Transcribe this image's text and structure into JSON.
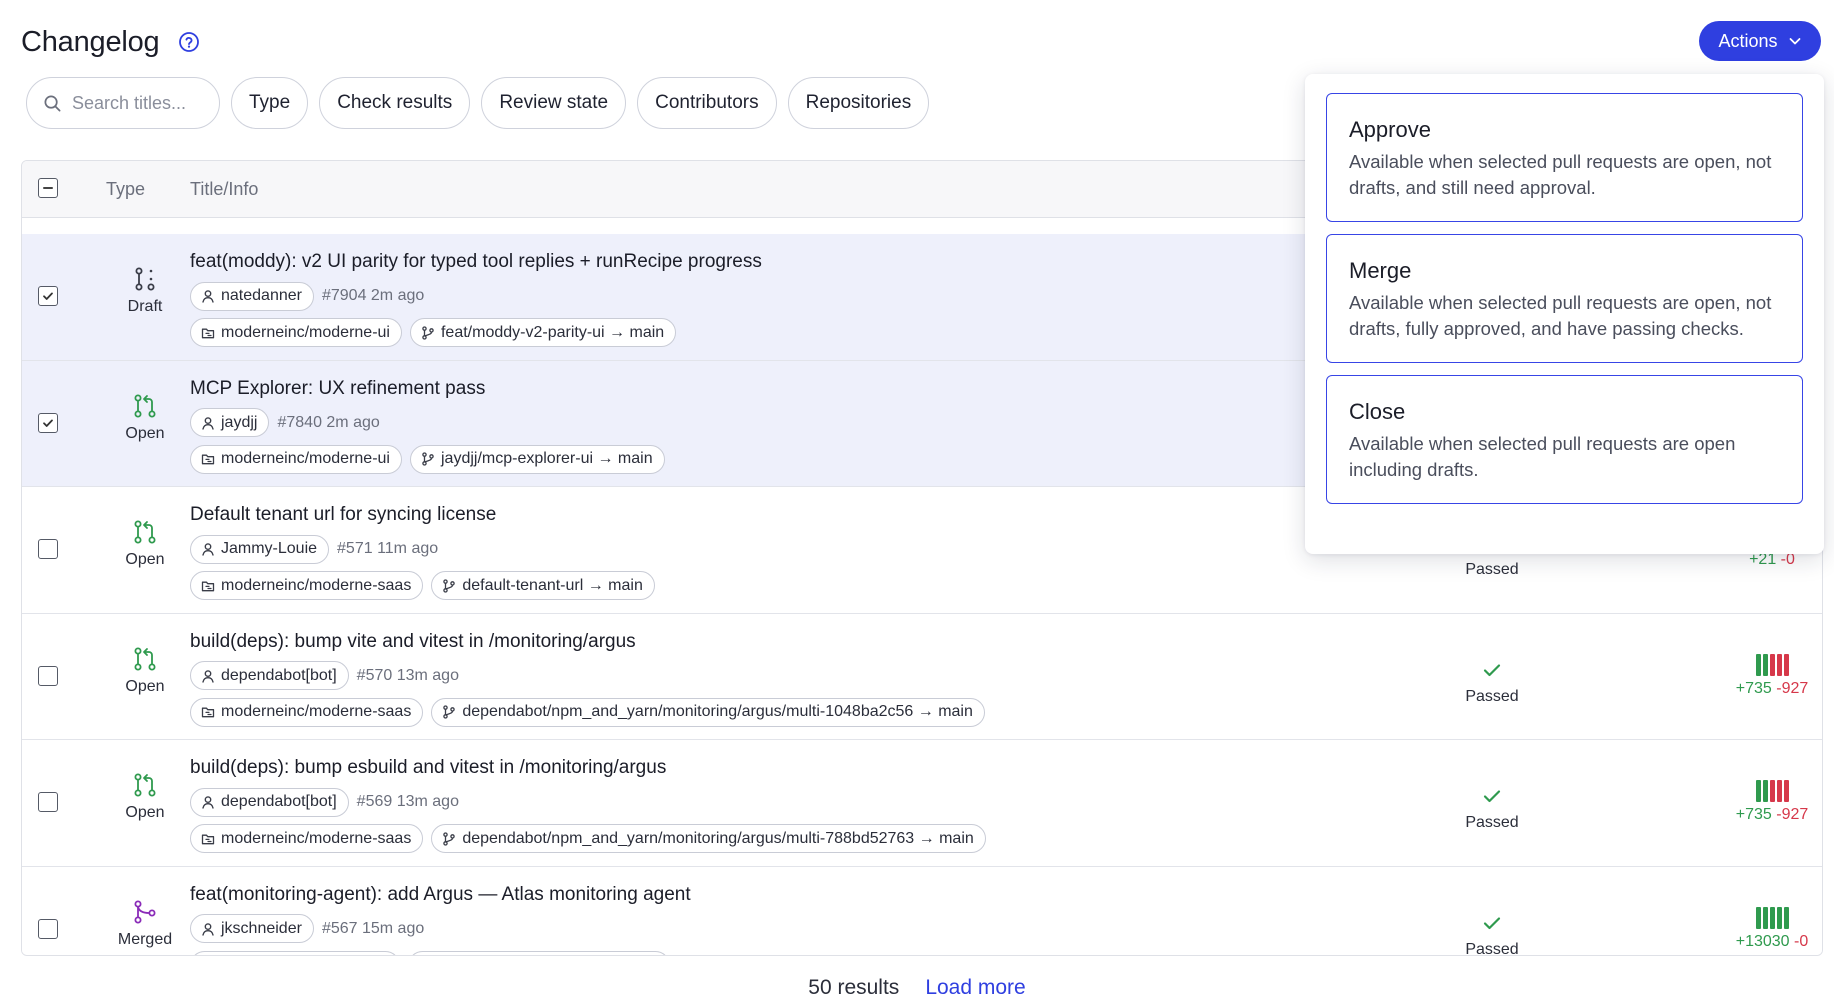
{
  "header": {
    "title": "Changelog",
    "actions_label": "Actions"
  },
  "filters": {
    "search_placeholder": "Search titles...",
    "chips": [
      "Type",
      "Check results",
      "Review state",
      "Contributors",
      "Repositories"
    ]
  },
  "table": {
    "columns": {
      "type": "Type",
      "title": "Title/Info"
    },
    "rows": [
      {
        "selected": true,
        "type": "Draft",
        "type_icon": "draft-pr-icon",
        "title": "feat(moddy): v2 UI parity for typed tool replies + runRecipe progress",
        "author": "natedanner",
        "meta": "#7904 2m ago",
        "repo": "moderneinc/moderne-ui",
        "branch": "feat/moddy-v2-parity-ui → main",
        "checks": "",
        "additions": "",
        "deletions": ""
      },
      {
        "selected": true,
        "type": "Open",
        "type_icon": "open-pr-icon",
        "title": "MCP Explorer: UX refinement pass",
        "author": "jaydjj",
        "meta": "#7840 2m ago",
        "repo": "moderneinc/moderne-ui",
        "branch": "jaydjj/mcp-explorer-ui → main",
        "checks": "",
        "additions": "",
        "deletions": ""
      },
      {
        "selected": false,
        "type": "Open",
        "type_icon": "open-pr-icon",
        "title": "Default tenant url for syncing license",
        "author": "Jammy-Louie",
        "meta": "#571 11m ago",
        "repo": "moderneinc/moderne-saas",
        "branch": "default-tenant-url → main",
        "checks": "Passed",
        "additions": "+21",
        "deletions": "-0"
      },
      {
        "selected": false,
        "type": "Open",
        "type_icon": "open-pr-icon",
        "title": "build(deps): bump vite and vitest in /monitoring/argus",
        "author": "dependabot[bot]",
        "meta": "#570 13m ago",
        "repo": "moderneinc/moderne-saas",
        "branch": "dependabot/npm_and_yarn/monitoring/argus/multi-1048ba2c56 → main",
        "checks": "Passed",
        "additions": "+735",
        "deletions": "-927",
        "diff_bars": [
          "add",
          "add",
          "del",
          "del",
          "del"
        ]
      },
      {
        "selected": false,
        "type": "Open",
        "type_icon": "open-pr-icon",
        "title": "build(deps): bump esbuild and vitest in /monitoring/argus",
        "author": "dependabot[bot]",
        "meta": "#569 13m ago",
        "repo": "moderneinc/moderne-saas",
        "branch": "dependabot/npm_and_yarn/monitoring/argus/multi-788bd52763 → main",
        "checks": "Passed",
        "additions": "+735",
        "deletions": "-927",
        "diff_bars": [
          "add",
          "add",
          "del",
          "del",
          "del"
        ]
      },
      {
        "selected": false,
        "type": "Merged",
        "type_icon": "merged-pr-icon",
        "title": "feat(monitoring-agent): add Argus — Atlas monitoring agent",
        "author": "jkschneider",
        "meta": "#567 15m ago",
        "repo": "",
        "branch": "",
        "checks": "Passed",
        "additions": "+13030",
        "deletions": "-0",
        "diff_bars": [
          "add",
          "add",
          "add",
          "add",
          "add"
        ]
      }
    ]
  },
  "footer": {
    "results": "50 results",
    "load_more": "Load more"
  },
  "actions_menu": [
    {
      "title": "Approve",
      "description": "Available when selected pull requests are open, not drafts, and still need approval."
    },
    {
      "title": "Merge",
      "description": "Available when selected pull requests are open, not drafts, fully approved, and have passing checks."
    },
    {
      "title": "Close",
      "description": "Available when selected pull requests are open including drafts."
    }
  ],
  "colors": {
    "accent": "#2f3fe0",
    "open": "#2f9a4e",
    "merged": "#8a2bb8",
    "deleted": "#d6384a",
    "selected_row": "#eef0fb"
  }
}
